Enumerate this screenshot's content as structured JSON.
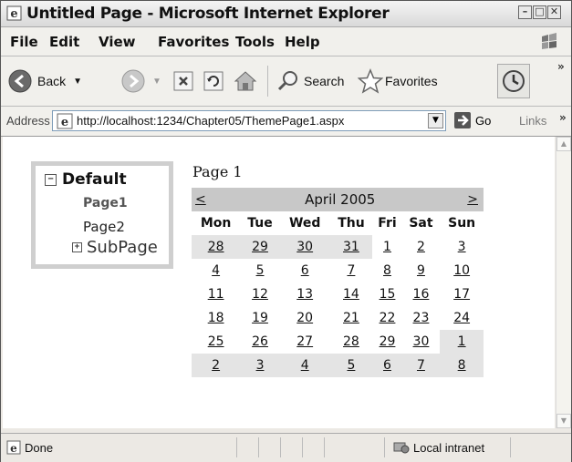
{
  "window": {
    "title": "Untitled Page - Microsoft Internet Explorer"
  },
  "menu": [
    {
      "label": "File"
    },
    {
      "label": "Edit"
    },
    {
      "label": "View"
    },
    {
      "label": "Favorites"
    },
    {
      "label": "Tools"
    },
    {
      "label": "Help"
    }
  ],
  "toolbar": {
    "back_label": "Back",
    "search_label": "Search",
    "favorites_label": "Favorites"
  },
  "address": {
    "label": "Address",
    "url": "http://localhost:1234/Chapter05/ThemePage1.aspx",
    "go_label": "Go",
    "links_label": "Links"
  },
  "tree": {
    "root": "Default",
    "children": [
      "Page1",
      "Page2",
      "SubPage"
    ]
  },
  "page": {
    "heading": "Page 1"
  },
  "calendar": {
    "prev": "<",
    "next": ">",
    "month": "April 2005",
    "days": [
      "Mon",
      "Tue",
      "Wed",
      "Thu",
      "Fri",
      "Sat",
      "Sun"
    ],
    "weeks": [
      [
        "28",
        "29",
        "30",
        "31",
        "1",
        "2",
        "3"
      ],
      [
        "4",
        "5",
        "6",
        "7",
        "8",
        "9",
        "10"
      ],
      [
        "11",
        "12",
        "13",
        "14",
        "15",
        "16",
        "17"
      ],
      [
        "18",
        "19",
        "20",
        "21",
        "22",
        "23",
        "24"
      ],
      [
        "25",
        "26",
        "27",
        "28",
        "29",
        "30",
        "1"
      ],
      [
        "2",
        "3",
        "4",
        "5",
        "6",
        "7",
        "8"
      ]
    ]
  },
  "status": {
    "text": "Done",
    "zone": "Local intranet"
  }
}
